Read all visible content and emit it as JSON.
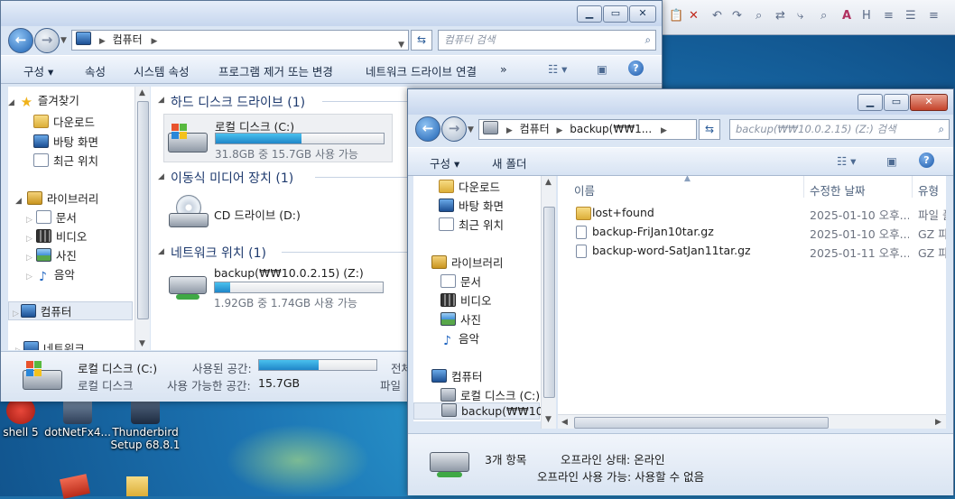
{
  "desktop": {
    "icons": [
      {
        "label": "shell 5"
      },
      {
        "label": "dotNetFx4..."
      },
      {
        "label": "Thunderbird Setup 68.8.1"
      }
    ]
  },
  "win1": {
    "address": "컴퓨터",
    "search_placeholder": "컴퓨터 검색",
    "toolbar": {
      "organize": "구성",
      "properties": "속성",
      "system_properties": "시스템 속성",
      "uninstall": "프로그램 제거 또는 변경",
      "map_drive": "네트워크 드라이브 연결",
      "more": "»"
    },
    "nav": {
      "favorites": "즐겨찾기",
      "downloads": "다운로드",
      "desktop": "바탕 화면",
      "recent": "최근 위치",
      "libraries": "라이브러리",
      "documents": "문서",
      "videos": "비디오",
      "pictures": "사진",
      "music": "음악",
      "computer": "컴퓨터",
      "network": "네트워크"
    },
    "groups": {
      "hdd": "하드 디스크 드라이브 (1)",
      "removable": "이동식 미디어 장치 (1)",
      "network": "네트워크 위치 (1)"
    },
    "drives": {
      "c_name": "로컬 디스크 (C:)",
      "c_free": "31.8GB 중 15.7GB 사용 가능",
      "c_used_fraction": 0.51,
      "d_name": "CD 드라이브 (D:)",
      "z_name": "backup(₩₩10.0.2.15) (Z:)",
      "z_free": "1.92GB 중 1.74GB 사용 가능",
      "z_used_fraction": 0.09
    },
    "details": {
      "name": "로컬 디스크 (C:)",
      "type": "로컬 디스크",
      "used_label": "사용된 공간:",
      "free_label": "사용 가능한 공간:",
      "free_value": "15.7GB",
      "total_label": "전체",
      "fs_label": "파일",
      "used_fraction": 0.51
    }
  },
  "win2": {
    "breadcrumb": [
      "컴퓨터",
      "backup(₩₩1..."
    ],
    "search_placeholder": "backup(₩₩10.0.2.15) (Z:) 검색",
    "toolbar": {
      "organize": "구성",
      "new_folder": "새 폴더"
    },
    "nav": {
      "downloads": "다운로드",
      "desktop": "바탕 화면",
      "recent": "최근 위치",
      "libraries": "라이브러리",
      "documents": "문서",
      "videos": "비디오",
      "pictures": "사진",
      "music": "음악",
      "computer": "컴퓨터",
      "local_disk": "로컬 디스크 (C:)",
      "backup": "backup(₩₩10.0..."
    },
    "columns": {
      "name": "이름",
      "modified": "수정한 날짜",
      "type": "유형"
    },
    "files": [
      {
        "name": "lost+found",
        "modified": "2025-01-10 오후...",
        "type": "파일 폴",
        "kind": "folder"
      },
      {
        "name": "backup-FriJan10tar.gz",
        "modified": "2025-01-10 오후...",
        "type": "GZ 파",
        "kind": "file"
      },
      {
        "name": "backup-word-SatJan11tar.gz",
        "modified": "2025-01-11 오후...",
        "type": "GZ 파",
        "kind": "file"
      }
    ],
    "status": {
      "count": "3개 항목",
      "offline_status": "오프라인 상태: 온라인",
      "offline_avail": "오프라인 사용 가능: 사용할 수 없음"
    }
  },
  "colors": {
    "accent": "#1f86c8",
    "title_text": "#1e3a6e"
  }
}
